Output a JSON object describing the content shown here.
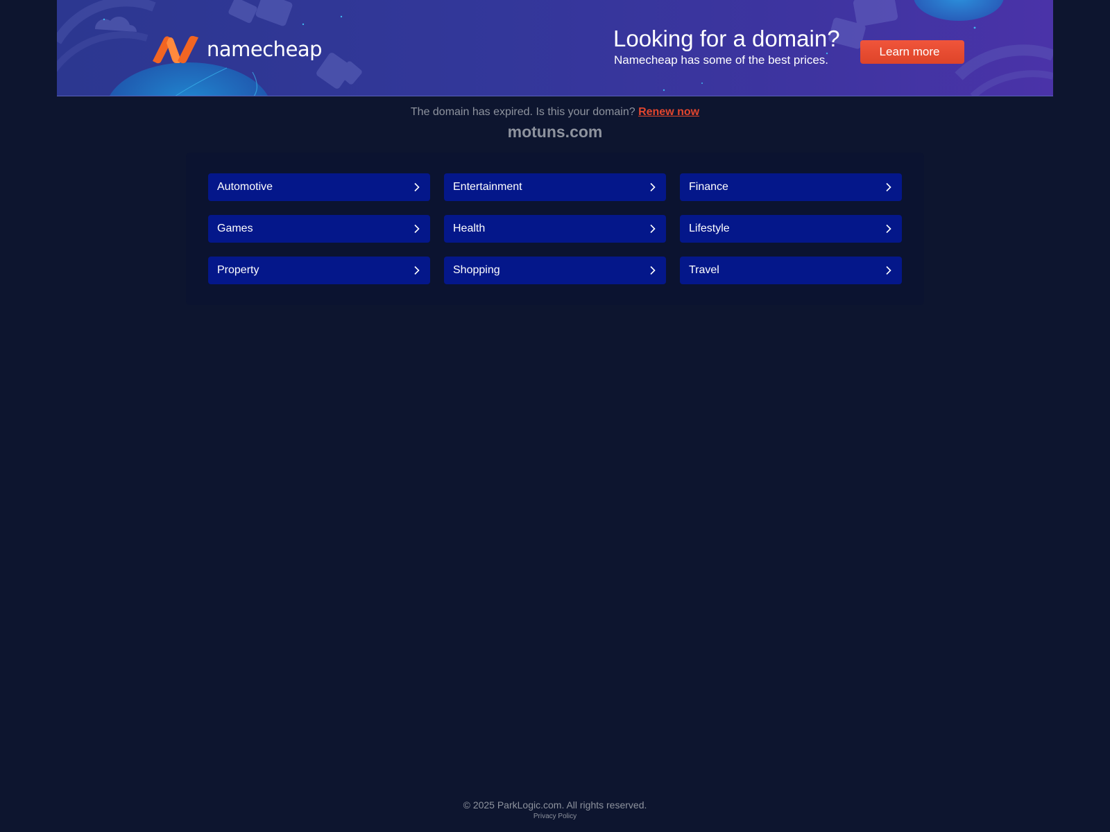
{
  "banner": {
    "brand": "namecheap",
    "headline": "Looking for a domain?",
    "subline": "Namecheap has some of the best prices.",
    "cta_label": "Learn more",
    "colors": {
      "brand_orange": "#f26522",
      "cta": "#e2462e",
      "background": "#33379a"
    }
  },
  "notice": {
    "text": "The domain has expired. Is this your domain?",
    "link_label": "Renew now"
  },
  "domain": "motuns.com",
  "categories": [
    {
      "label": "Automotive"
    },
    {
      "label": "Entertainment"
    },
    {
      "label": "Finance"
    },
    {
      "label": "Games"
    },
    {
      "label": "Health"
    },
    {
      "label": "Lifestyle"
    },
    {
      "label": "Property"
    },
    {
      "label": "Shopping"
    },
    {
      "label": "Travel"
    }
  ],
  "category_icon": "chevron-right-icon",
  "footer": {
    "copyright": "© 2025 ParkLogic.com. All rights reserved.",
    "privacy_label": "Privacy Policy"
  }
}
